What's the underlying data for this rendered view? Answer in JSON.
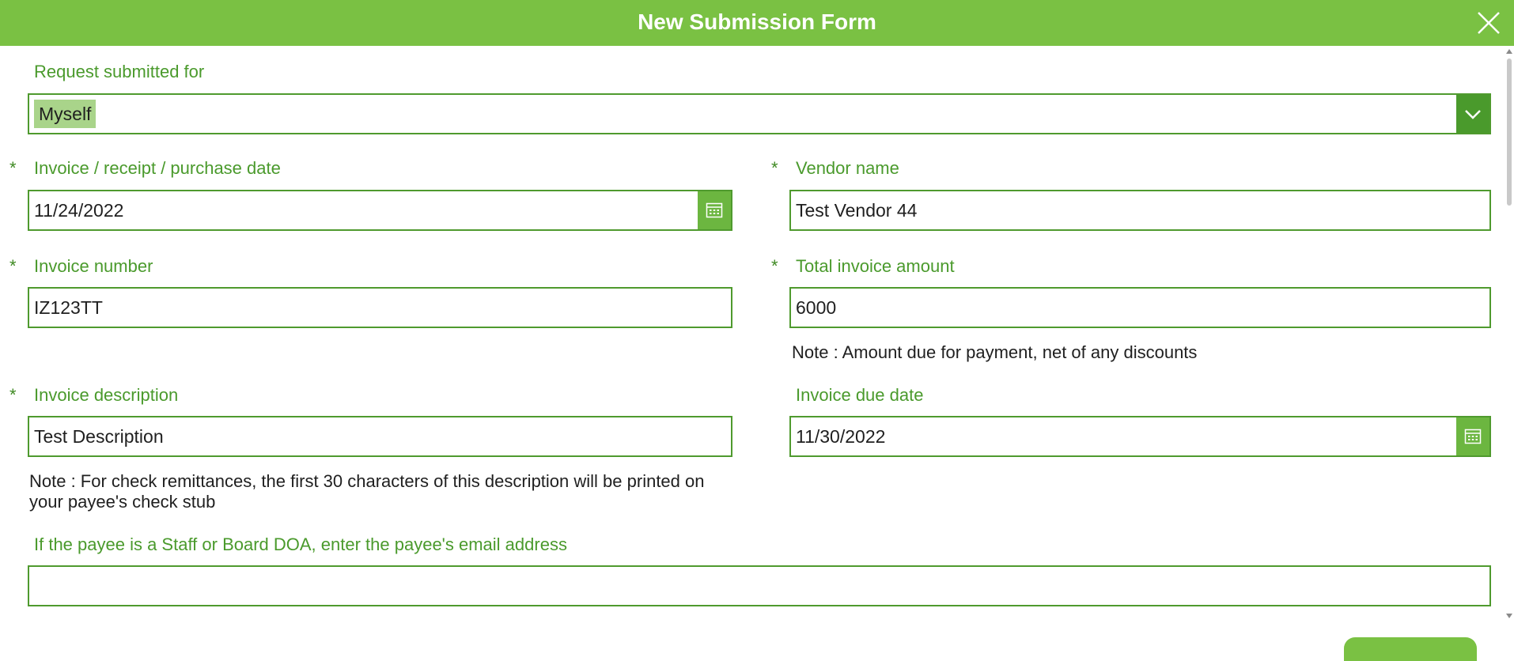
{
  "header": {
    "title": "New Submission Form"
  },
  "colors": {
    "brand": "#7ac143",
    "label": "#4a9a2c",
    "border": "#4f9a2e"
  },
  "icons": {
    "close": "close-icon",
    "dropdown": "chevron-down-icon",
    "calendar": "calendar-icon"
  },
  "form": {
    "required_marker": "*",
    "request_for": {
      "label": "Request submitted for",
      "value": "Myself"
    },
    "invoice_date": {
      "label": "Invoice / receipt / purchase date",
      "value": "11/24/2022"
    },
    "vendor_name": {
      "label": "Vendor name",
      "value": "Test Vendor 44"
    },
    "invoice_number": {
      "label": "Invoice number",
      "value": "IZ123TT"
    },
    "total_amount": {
      "label": "Total invoice amount",
      "value": "6000",
      "note": "Note : Amount due for payment, net of any discounts"
    },
    "invoice_description": {
      "label": "Invoice description",
      "value": "Test Description",
      "note": "Note : For check remittances, the first 30 characters of this description will be printed on your payee's check stub"
    },
    "due_date": {
      "label": "Invoice due date",
      "value": "11/30/2022"
    },
    "payee_email": {
      "label": "If the payee is a Staff or Board DOA, enter the payee's email address",
      "value": ""
    }
  }
}
